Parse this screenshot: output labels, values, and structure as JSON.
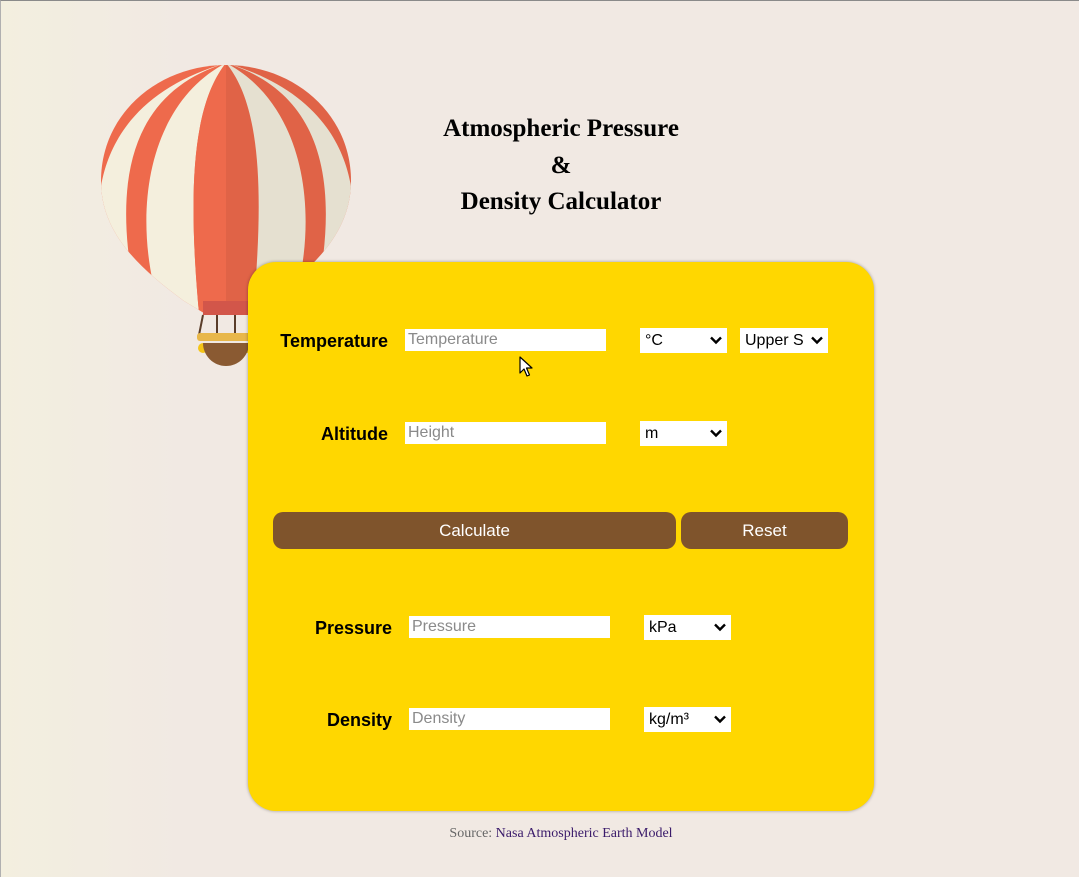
{
  "header": {
    "title_line1": "Atmospheric Pressure",
    "title_line2": "&",
    "title_line3": "Density Calculator"
  },
  "form": {
    "temperature": {
      "label": "Temperature",
      "placeholder": "Temperature",
      "value": "",
      "unit": "°C",
      "region": "Upper S"
    },
    "altitude": {
      "label": "Altitude",
      "placeholder": "Height",
      "value": "",
      "unit": "m"
    },
    "calculate_label": "Calculate",
    "reset_label": "Reset",
    "pressure": {
      "label": "Pressure",
      "placeholder": "Pressure",
      "value": "",
      "unit": "kPa"
    },
    "density": {
      "label": "Density",
      "placeholder": "Density",
      "value": "",
      "unit": "kg/m³"
    }
  },
  "footer": {
    "source_prefix": "Source:",
    "source_link": "Nasa Atmospheric Earth Model"
  },
  "colors": {
    "card": "#ffd700",
    "button": "#7f542c",
    "balloon_red": "#ee6a4c",
    "balloon_cream": "#f4efdd"
  },
  "icons": {
    "balloon": "hot-air-balloon-illustration",
    "chevron": "chevron-down-icon",
    "cursor": "mouse-pointer-icon"
  }
}
